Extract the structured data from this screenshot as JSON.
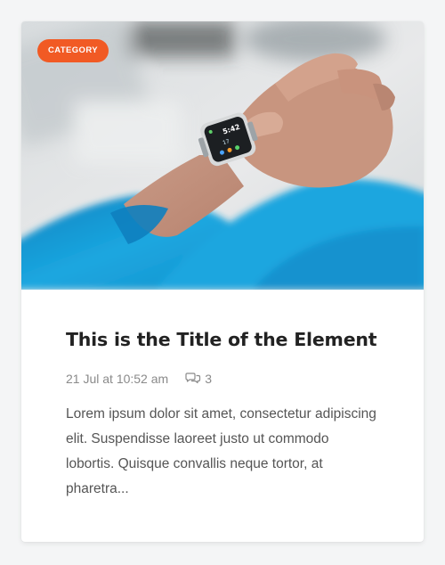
{
  "card": {
    "category": "CATEGORY",
    "image_alt": "Person checking a smartwatch on their wrist",
    "title": "This is the Title of the Element",
    "date": "21 Jul at 10:52 am",
    "comments_count": "3",
    "comments_icon": "comment-bubbles-icon",
    "watch_time": "5:42",
    "watch_sub": "17",
    "excerpt": "Lorem ipsum dolor sit amet, consectetur adipiscing elit. Suspendisse laoreet justo ut commodo lobortis. Quisque convallis neque tortor, at pharetra..."
  },
  "colors": {
    "accent": "#f15a24",
    "sleeve": "#1a9dd9",
    "title": "#222222",
    "meta": "#8a8a8a",
    "text": "#555555",
    "card_bg": "#ffffff",
    "page_bg": "#f4f5f6"
  }
}
